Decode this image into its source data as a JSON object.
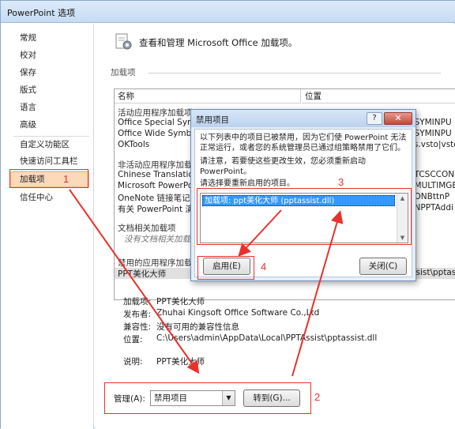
{
  "window": {
    "title": "PowerPoint 选项"
  },
  "nav": {
    "items": [
      {
        "label": "常规"
      },
      {
        "label": "校对"
      },
      {
        "label": "保存"
      },
      {
        "label": "版式"
      },
      {
        "label": "语言"
      },
      {
        "label": "高级"
      },
      {
        "label": "自定义功能区"
      },
      {
        "label": "快速访问工具栏"
      },
      {
        "label": "加载项"
      },
      {
        "label": "信任中心"
      }
    ],
    "selected": "加载项"
  },
  "content": {
    "header": "查看和管理 Microsoft Office 加载项。",
    "group_label": "加载项",
    "table": {
      "col_name": "名称",
      "col_location": "位置",
      "active_category": "活动应用程序加载项",
      "active_rows": [
        {
          "name": "Office Special Symb",
          "location": "\\SYMINPU"
        },
        {
          "name": "Office Wide Symbo",
          "location": "\\SYMINPU"
        },
        {
          "name": "OKTools",
          "location": "ls.vsto|vsto"
        }
      ],
      "inactive_category": "非活动应用程序加载项",
      "inactive_rows": [
        {
          "name": "Chinese Translation",
          "location": "\\TCSCCON"
        },
        {
          "name": "Microsoft PowerPoi",
          "location": "\\MULTIMGB"
        },
        {
          "name": "OneNote 链接笔记加",
          "location": "\\ONBttnP"
        },
        {
          "name": "有关 PowerPoint 演示",
          "location": "\\NPPTAddi"
        }
      ],
      "doc_category": "文档相关加载项",
      "doc_note": "没有文档相关加载项",
      "disabled_category": "禁用的应用程序加载项",
      "disabled_row": {
        "name": "PPT美化大师",
        "location": "ssist\\pptas"
      }
    },
    "details": {
      "addin_k": "加载项:",
      "addin_v": "PPT美化大师",
      "publisher_k": "发布者:",
      "publisher_v": "Zhuhai Kingsoft Office Software Co.,Ltd",
      "compat_k": "兼容性:",
      "compat_v": "没有可用的兼容性信息",
      "location_k": "位置:",
      "location_v": "C:\\Users\\admin\\AppData\\Local\\PPTAssist\\pptassist.dll",
      "desc_k": "说明:",
      "desc_v": "PPT美化大师"
    },
    "manage": {
      "label": "管理(A):",
      "select_value": "禁用项目",
      "go_button": "转到(G)..."
    }
  },
  "dialog": {
    "title": "禁用项目",
    "help": "?",
    "close": "✕",
    "line1": "以下列表中的项目已被禁用，因为它们使 PowerPoint 无法",
    "line2": "正常运行，或者您的系统管理员已通过组策略禁用了它们。",
    "line3": "请注意，若要使这些更改生效，您必须重新启动",
    "line4": "PowerPoint。",
    "line5": "请选择要重新启用的项目。",
    "list_item": "加载项: ppt美化大师 (pptassist.dll)",
    "enable_button": "启用(E)",
    "close_button": "关闭(C)"
  },
  "annotations": {
    "n1": "1",
    "n2": "2",
    "n3": "3",
    "n4": "4",
    "color": "#e8312c"
  }
}
